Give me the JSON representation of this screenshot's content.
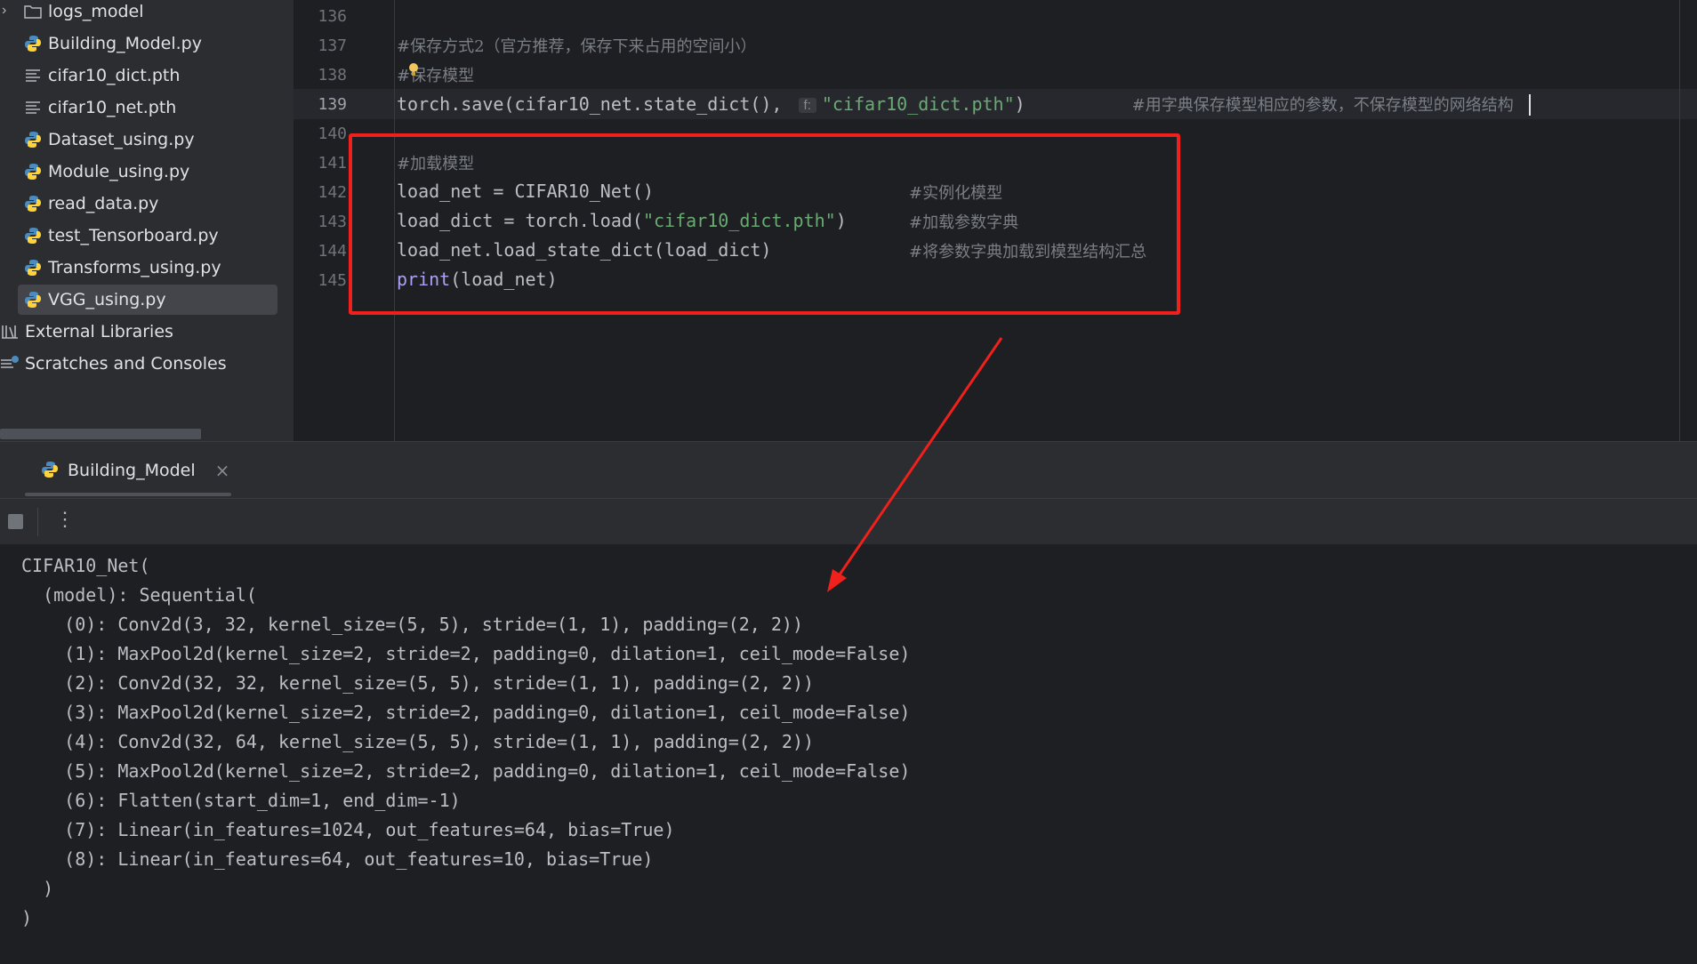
{
  "project": {
    "items": [
      {
        "label": "logs_model",
        "icon": "folder-icon"
      },
      {
        "label": "Building_Model.py",
        "icon": "python-icon"
      },
      {
        "label": "cifar10_dict.pth",
        "icon": "text-file-icon"
      },
      {
        "label": "cifar10_net.pth",
        "icon": "text-file-icon"
      },
      {
        "label": "Dataset_using.py",
        "icon": "python-icon"
      },
      {
        "label": "Module_using.py",
        "icon": "python-icon"
      },
      {
        "label": "read_data.py",
        "icon": "python-icon"
      },
      {
        "label": "test_Tensorboard.py",
        "icon": "python-icon"
      },
      {
        "label": "Transforms_using.py",
        "icon": "python-icon"
      },
      {
        "label": "VGG_using.py",
        "icon": "python-icon",
        "selected": true
      },
      {
        "label": "External Libraries",
        "icon": "library-icon"
      },
      {
        "label": "Scratches and Consoles",
        "icon": "scratches-icon"
      }
    ]
  },
  "editor": {
    "line_numbers": [
      "136",
      "137",
      "138",
      "139",
      "140",
      "141",
      "142",
      "143",
      "144",
      "145"
    ],
    "current_line": "139",
    "line137": "#保存方式2（官方推荐，保存下来占用的空间小）",
    "line138": "#保存模型",
    "line139": {
      "code": "torch.save(cifar10_net.state_dict(), ",
      "hint": "f:",
      "str": "\"cifar10_dict.pth\"",
      "close": ")",
      "comment": "#用字典保存模型相应的参数，不保存模型的网络结构"
    },
    "line141": "#加载模型",
    "line142": {
      "code": "load_net = CIFAR10_Net()",
      "comment": "#实例化模型"
    },
    "line143": {
      "code_a": "load_dict = torch.load(",
      "str": "\"cifar10_dict.pth\"",
      "code_b": ")",
      "comment": "#加载参数字典"
    },
    "line144": {
      "code": "load_net.load_state_dict(load_dict)",
      "comment": "#将参数字典加载到模型结构汇总"
    },
    "line145": {
      "fn": "print",
      "rest": "(load_net)"
    }
  },
  "run_panel": {
    "tab_label": "Building_Model",
    "close_symbol": "×",
    "menu_symbol": "⋮"
  },
  "console": {
    "lines": [
      "CIFAR10_Net(",
      "  (model): Sequential(",
      "    (0): Conv2d(3, 32, kernel_size=(5, 5), stride=(1, 1), padding=(2, 2))",
      "    (1): MaxPool2d(kernel_size=2, stride=2, padding=0, dilation=1, ceil_mode=False)",
      "    (2): Conv2d(32, 32, kernel_size=(5, 5), stride=(1, 1), padding=(2, 2))",
      "    (3): MaxPool2d(kernel_size=2, stride=2, padding=0, dilation=1, ceil_mode=False)",
      "    (4): Conv2d(32, 64, kernel_size=(5, 5), stride=(1, 1), padding=(2, 2))",
      "    (5): MaxPool2d(kernel_size=2, stride=2, padding=0, dilation=1, ceil_mode=False)",
      "    (6): Flatten(start_dim=1, end_dim=-1)",
      "    (7): Linear(in_features=1024, out_features=64, bias=True)",
      "    (8): Linear(in_features=64, out_features=10, bias=True)",
      "  )",
      ")"
    ]
  },
  "colors": {
    "annotation": "#f0201c",
    "string": "#6aab73",
    "comment": "#7a7e85",
    "keyword_fn": "#a9a1f5"
  }
}
